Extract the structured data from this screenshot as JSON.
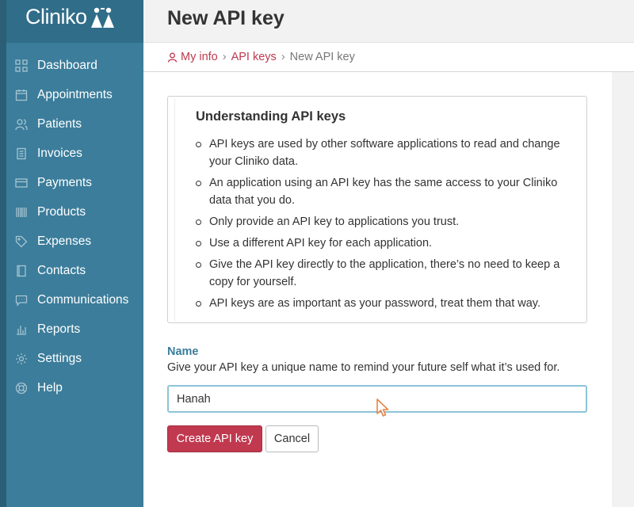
{
  "app": {
    "logo_text": "Cliniko"
  },
  "sidebar": {
    "items": [
      {
        "label": "Dashboard",
        "icon": "grid-icon"
      },
      {
        "label": "Appointments",
        "icon": "calendar-icon"
      },
      {
        "label": "Patients",
        "icon": "people-icon"
      },
      {
        "label": "Invoices",
        "icon": "document-icon"
      },
      {
        "label": "Payments",
        "icon": "credit-card-icon"
      },
      {
        "label": "Products",
        "icon": "barcode-icon"
      },
      {
        "label": "Expenses",
        "icon": "tag-icon"
      },
      {
        "label": "Contacts",
        "icon": "address-book-icon"
      },
      {
        "label": "Communications",
        "icon": "chat-icon"
      },
      {
        "label": "Reports",
        "icon": "bar-chart-icon"
      },
      {
        "label": "Settings",
        "icon": "gear-icon"
      },
      {
        "label": "Help",
        "icon": "lifebuoy-icon"
      }
    ]
  },
  "header": {
    "title": "New API key"
  },
  "breadcrumb": {
    "items": [
      "My info",
      "API keys"
    ],
    "current": "New API key",
    "separator": "›"
  },
  "info": {
    "title": "Understanding API keys",
    "bullets": [
      "API keys are used by other software applications to read and change your Cliniko data.",
      "An application using an API key has the same access to your Cliniko data that you do.",
      "Only provide an API key to applications you trust.",
      "Use a different API key for each application.",
      "Give the API key directly to the application, there’s no need to keep a copy for yourself.",
      "API keys are as important as your password, treat them that way."
    ]
  },
  "form": {
    "name_label": "Name",
    "name_help": "Give your API key a unique name to remind your future self what it’s used for.",
    "name_value": "Hanah",
    "submit_label": "Create API key",
    "cancel_label": "Cancel"
  },
  "colors": {
    "sidebar": "#3b7d9b",
    "accent": "#c0394f",
    "label": "#3b7d9b"
  }
}
